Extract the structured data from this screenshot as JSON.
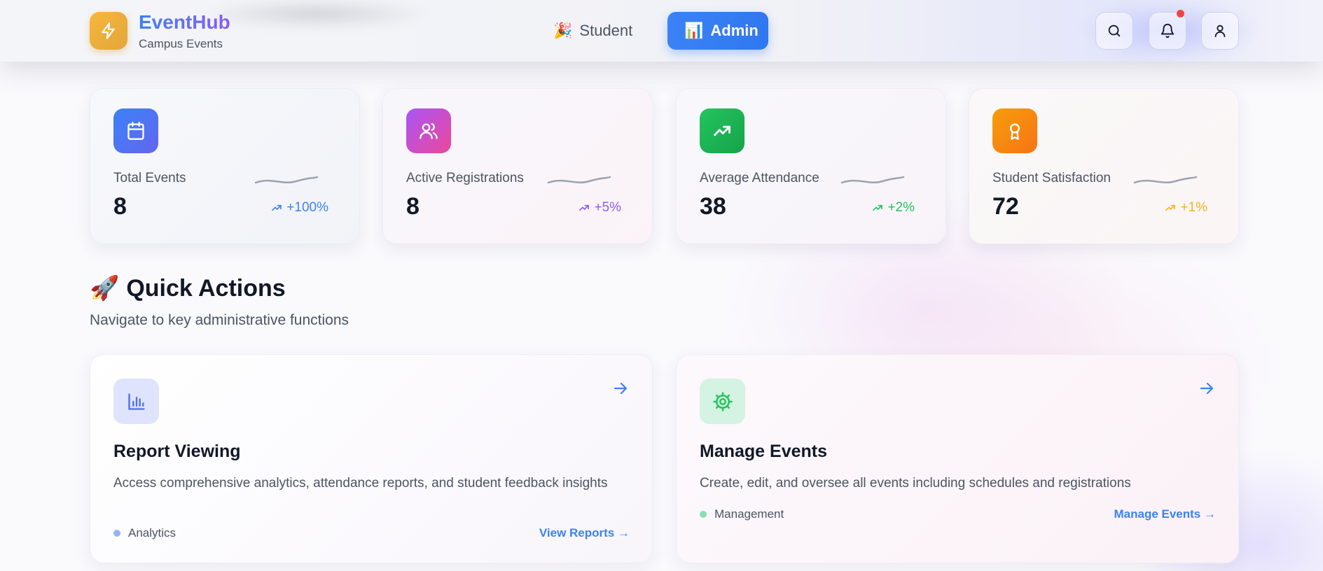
{
  "brand": {
    "name": "EventHub",
    "subtitle": "Campus Events",
    "icon": "lightning-bolt-icon"
  },
  "nav": {
    "student": {
      "emoji": "🎉",
      "label": "Student"
    },
    "admin": {
      "emoji": "📊",
      "label": "Admin",
      "active": true
    }
  },
  "header_actions": [
    "search-icon",
    "bell-icon",
    "user-icon"
  ],
  "stats": [
    {
      "label": "Total Events",
      "value": "8",
      "trend": "+100%",
      "icon": "calendar-icon",
      "color": "#3b82f6"
    },
    {
      "label": "Active Registrations",
      "value": "8",
      "trend": "+5%",
      "icon": "users-icon",
      "color": "#8b5cf6"
    },
    {
      "label": "Average Attendance",
      "value": "38",
      "trend": "+2%",
      "icon": "trending-up-icon",
      "color": "#22c55e"
    },
    {
      "label": "Student Satisfaction",
      "value": "72",
      "trend": "+1%",
      "icon": "award-icon",
      "color": "#f59e0b"
    }
  ],
  "quick_actions": {
    "emoji": "🚀",
    "title": "Quick Actions",
    "subtitle": "Navigate to key administrative functions",
    "cards": [
      {
        "title": "Report Viewing",
        "description": "Access comprehensive analytics, attendance reports, and student feedback insights",
        "tag": "Analytics",
        "link": "View Reports →",
        "icon": "bar-chart-icon"
      },
      {
        "title": "Manage Events",
        "description": "Create, edit, and oversee all events including schedules and registrations",
        "tag": "Management",
        "link": "Manage Events →",
        "icon": "gear-icon"
      }
    ]
  },
  "colors": {
    "accent": "#3b82f6",
    "purple": "#8b5cf6",
    "green": "#22c55e",
    "amber": "#f59e0b",
    "notification": "#ef4444"
  }
}
